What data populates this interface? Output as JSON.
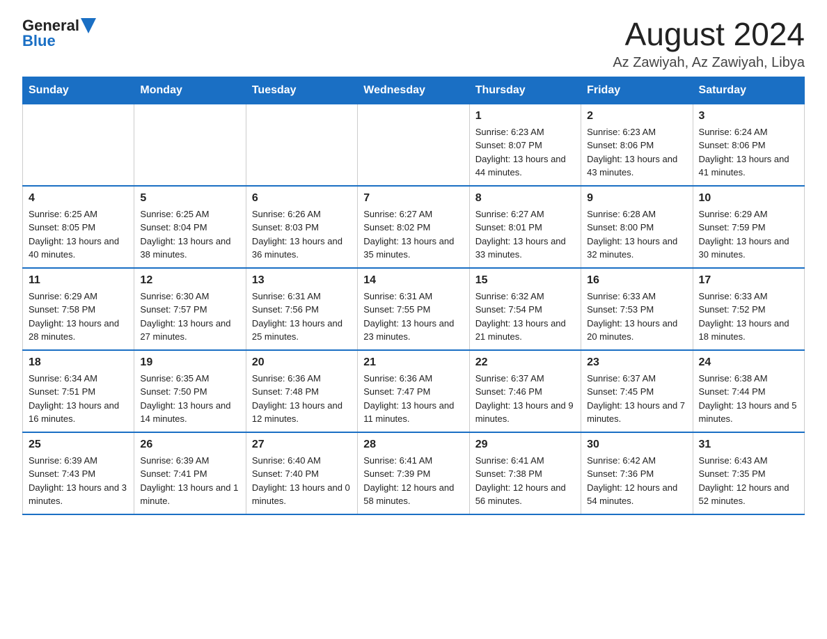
{
  "header": {
    "logo_general": "General",
    "logo_blue": "Blue",
    "title": "August 2024",
    "subtitle": "Az Zawiyah, Az Zawiyah, Libya"
  },
  "weekdays": [
    "Sunday",
    "Monday",
    "Tuesday",
    "Wednesday",
    "Thursday",
    "Friday",
    "Saturday"
  ],
  "weeks": [
    [
      {
        "day": "",
        "info": ""
      },
      {
        "day": "",
        "info": ""
      },
      {
        "day": "",
        "info": ""
      },
      {
        "day": "",
        "info": ""
      },
      {
        "day": "1",
        "info": "Sunrise: 6:23 AM\nSunset: 8:07 PM\nDaylight: 13 hours and 44 minutes."
      },
      {
        "day": "2",
        "info": "Sunrise: 6:23 AM\nSunset: 8:06 PM\nDaylight: 13 hours and 43 minutes."
      },
      {
        "day": "3",
        "info": "Sunrise: 6:24 AM\nSunset: 8:06 PM\nDaylight: 13 hours and 41 minutes."
      }
    ],
    [
      {
        "day": "4",
        "info": "Sunrise: 6:25 AM\nSunset: 8:05 PM\nDaylight: 13 hours and 40 minutes."
      },
      {
        "day": "5",
        "info": "Sunrise: 6:25 AM\nSunset: 8:04 PM\nDaylight: 13 hours and 38 minutes."
      },
      {
        "day": "6",
        "info": "Sunrise: 6:26 AM\nSunset: 8:03 PM\nDaylight: 13 hours and 36 minutes."
      },
      {
        "day": "7",
        "info": "Sunrise: 6:27 AM\nSunset: 8:02 PM\nDaylight: 13 hours and 35 minutes."
      },
      {
        "day": "8",
        "info": "Sunrise: 6:27 AM\nSunset: 8:01 PM\nDaylight: 13 hours and 33 minutes."
      },
      {
        "day": "9",
        "info": "Sunrise: 6:28 AM\nSunset: 8:00 PM\nDaylight: 13 hours and 32 minutes."
      },
      {
        "day": "10",
        "info": "Sunrise: 6:29 AM\nSunset: 7:59 PM\nDaylight: 13 hours and 30 minutes."
      }
    ],
    [
      {
        "day": "11",
        "info": "Sunrise: 6:29 AM\nSunset: 7:58 PM\nDaylight: 13 hours and 28 minutes."
      },
      {
        "day": "12",
        "info": "Sunrise: 6:30 AM\nSunset: 7:57 PM\nDaylight: 13 hours and 27 minutes."
      },
      {
        "day": "13",
        "info": "Sunrise: 6:31 AM\nSunset: 7:56 PM\nDaylight: 13 hours and 25 minutes."
      },
      {
        "day": "14",
        "info": "Sunrise: 6:31 AM\nSunset: 7:55 PM\nDaylight: 13 hours and 23 minutes."
      },
      {
        "day": "15",
        "info": "Sunrise: 6:32 AM\nSunset: 7:54 PM\nDaylight: 13 hours and 21 minutes."
      },
      {
        "day": "16",
        "info": "Sunrise: 6:33 AM\nSunset: 7:53 PM\nDaylight: 13 hours and 20 minutes."
      },
      {
        "day": "17",
        "info": "Sunrise: 6:33 AM\nSunset: 7:52 PM\nDaylight: 13 hours and 18 minutes."
      }
    ],
    [
      {
        "day": "18",
        "info": "Sunrise: 6:34 AM\nSunset: 7:51 PM\nDaylight: 13 hours and 16 minutes."
      },
      {
        "day": "19",
        "info": "Sunrise: 6:35 AM\nSunset: 7:50 PM\nDaylight: 13 hours and 14 minutes."
      },
      {
        "day": "20",
        "info": "Sunrise: 6:36 AM\nSunset: 7:48 PM\nDaylight: 13 hours and 12 minutes."
      },
      {
        "day": "21",
        "info": "Sunrise: 6:36 AM\nSunset: 7:47 PM\nDaylight: 13 hours and 11 minutes."
      },
      {
        "day": "22",
        "info": "Sunrise: 6:37 AM\nSunset: 7:46 PM\nDaylight: 13 hours and 9 minutes."
      },
      {
        "day": "23",
        "info": "Sunrise: 6:37 AM\nSunset: 7:45 PM\nDaylight: 13 hours and 7 minutes."
      },
      {
        "day": "24",
        "info": "Sunrise: 6:38 AM\nSunset: 7:44 PM\nDaylight: 13 hours and 5 minutes."
      }
    ],
    [
      {
        "day": "25",
        "info": "Sunrise: 6:39 AM\nSunset: 7:43 PM\nDaylight: 13 hours and 3 minutes."
      },
      {
        "day": "26",
        "info": "Sunrise: 6:39 AM\nSunset: 7:41 PM\nDaylight: 13 hours and 1 minute."
      },
      {
        "day": "27",
        "info": "Sunrise: 6:40 AM\nSunset: 7:40 PM\nDaylight: 13 hours and 0 minutes."
      },
      {
        "day": "28",
        "info": "Sunrise: 6:41 AM\nSunset: 7:39 PM\nDaylight: 12 hours and 58 minutes."
      },
      {
        "day": "29",
        "info": "Sunrise: 6:41 AM\nSunset: 7:38 PM\nDaylight: 12 hours and 56 minutes."
      },
      {
        "day": "30",
        "info": "Sunrise: 6:42 AM\nSunset: 7:36 PM\nDaylight: 12 hours and 54 minutes."
      },
      {
        "day": "31",
        "info": "Sunrise: 6:43 AM\nSunset: 7:35 PM\nDaylight: 12 hours and 52 minutes."
      }
    ]
  ]
}
